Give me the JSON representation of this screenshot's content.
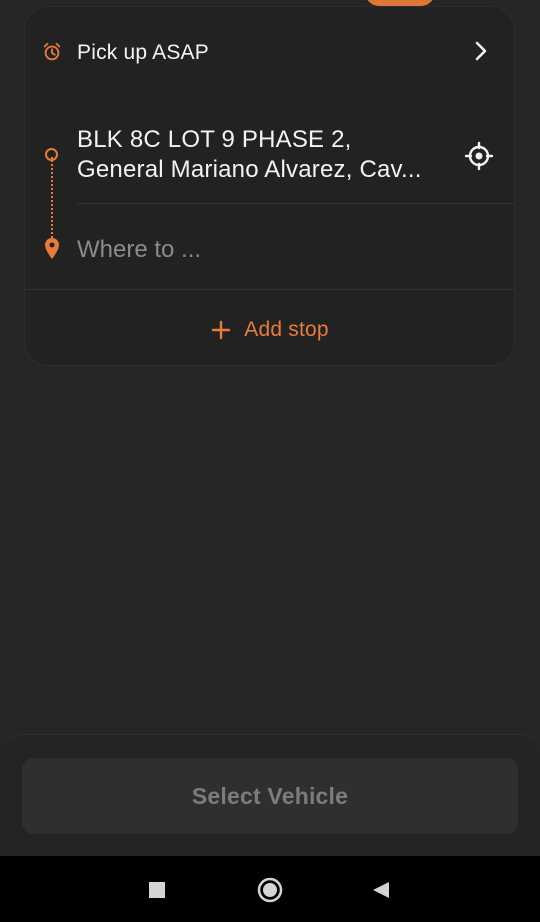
{
  "pickup": {
    "label": "Pick up ASAP"
  },
  "route": {
    "origin_line1": "BLK 8C LOT 9 PHASE 2,",
    "origin_line2": "General Mariano Alvarez, Cav...",
    "destination_placeholder": "Where to ..."
  },
  "actions": {
    "add_stop_label": "Add stop",
    "select_vehicle_label": "Select Vehicle"
  },
  "colors": {
    "accent": "#e77b3a",
    "background": "#262626",
    "card": "#222222"
  },
  "icons": [
    "alarm-clock-icon",
    "chevron-right-icon",
    "origin-dot-icon",
    "destination-pin-icon",
    "locate-icon",
    "plus-icon",
    "recent-apps-icon",
    "home-icon",
    "back-icon"
  ]
}
